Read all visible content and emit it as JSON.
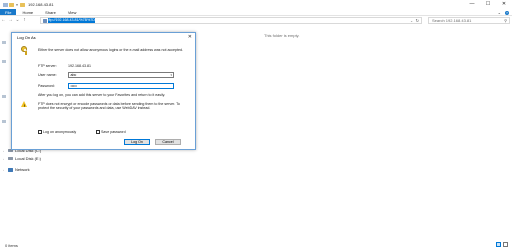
{
  "window": {
    "title": "192.168.43.81",
    "controls": {
      "minimize": "—",
      "maximize": "☐",
      "close": "✕"
    }
  },
  "ribbon": {
    "tabs": [
      "File",
      "Home",
      "Share",
      "View"
    ],
    "expand_icon": "chevron-down-icon",
    "help_icon": "?"
  },
  "navigation": {
    "back": "←",
    "forward": "→",
    "recent": "⌄",
    "up": "↑",
    "address": "ftp://192.168.43.81/%7B%7D",
    "refresh": "↻",
    "dropdown": "⌄",
    "search_placeholder": "Search 192.168.43.81",
    "search_icon": "⚲"
  },
  "nav_pane": {
    "items": [
      {
        "label": "Local Disk (C:)",
        "icon": "drive-icon"
      },
      {
        "label": "Local Disk (E:)",
        "icon": "drive-icon"
      },
      {
        "label": "Network",
        "icon": "network-icon"
      }
    ]
  },
  "content": {
    "empty_message": "This folder is empty."
  },
  "status_bar": {
    "item_count": "0 items"
  },
  "dialog": {
    "title": "Log On As",
    "close": "✕",
    "message": "Either the server does not allow anonymous logins or the e-mail address was not accepted.",
    "ftp_server_label": "FTP server:",
    "ftp_server_value": "192.168.43.81",
    "username_label": "User name:",
    "username_value": "abc",
    "password_label": "Password:",
    "password_value": "•••••",
    "favorites_note": "After you log on, you can add this server to your Favorites and return to it easily.",
    "security_warning": "FTP does not encrypt or encode passwords or data before sending them to the server. To protect the security of your passwords and data, use WebDAV instead.",
    "anon_checkbox_label": "Log on anonymously",
    "save_checkbox_label": "Save password",
    "logon_button": "Log On",
    "cancel_button": "Cancel"
  }
}
